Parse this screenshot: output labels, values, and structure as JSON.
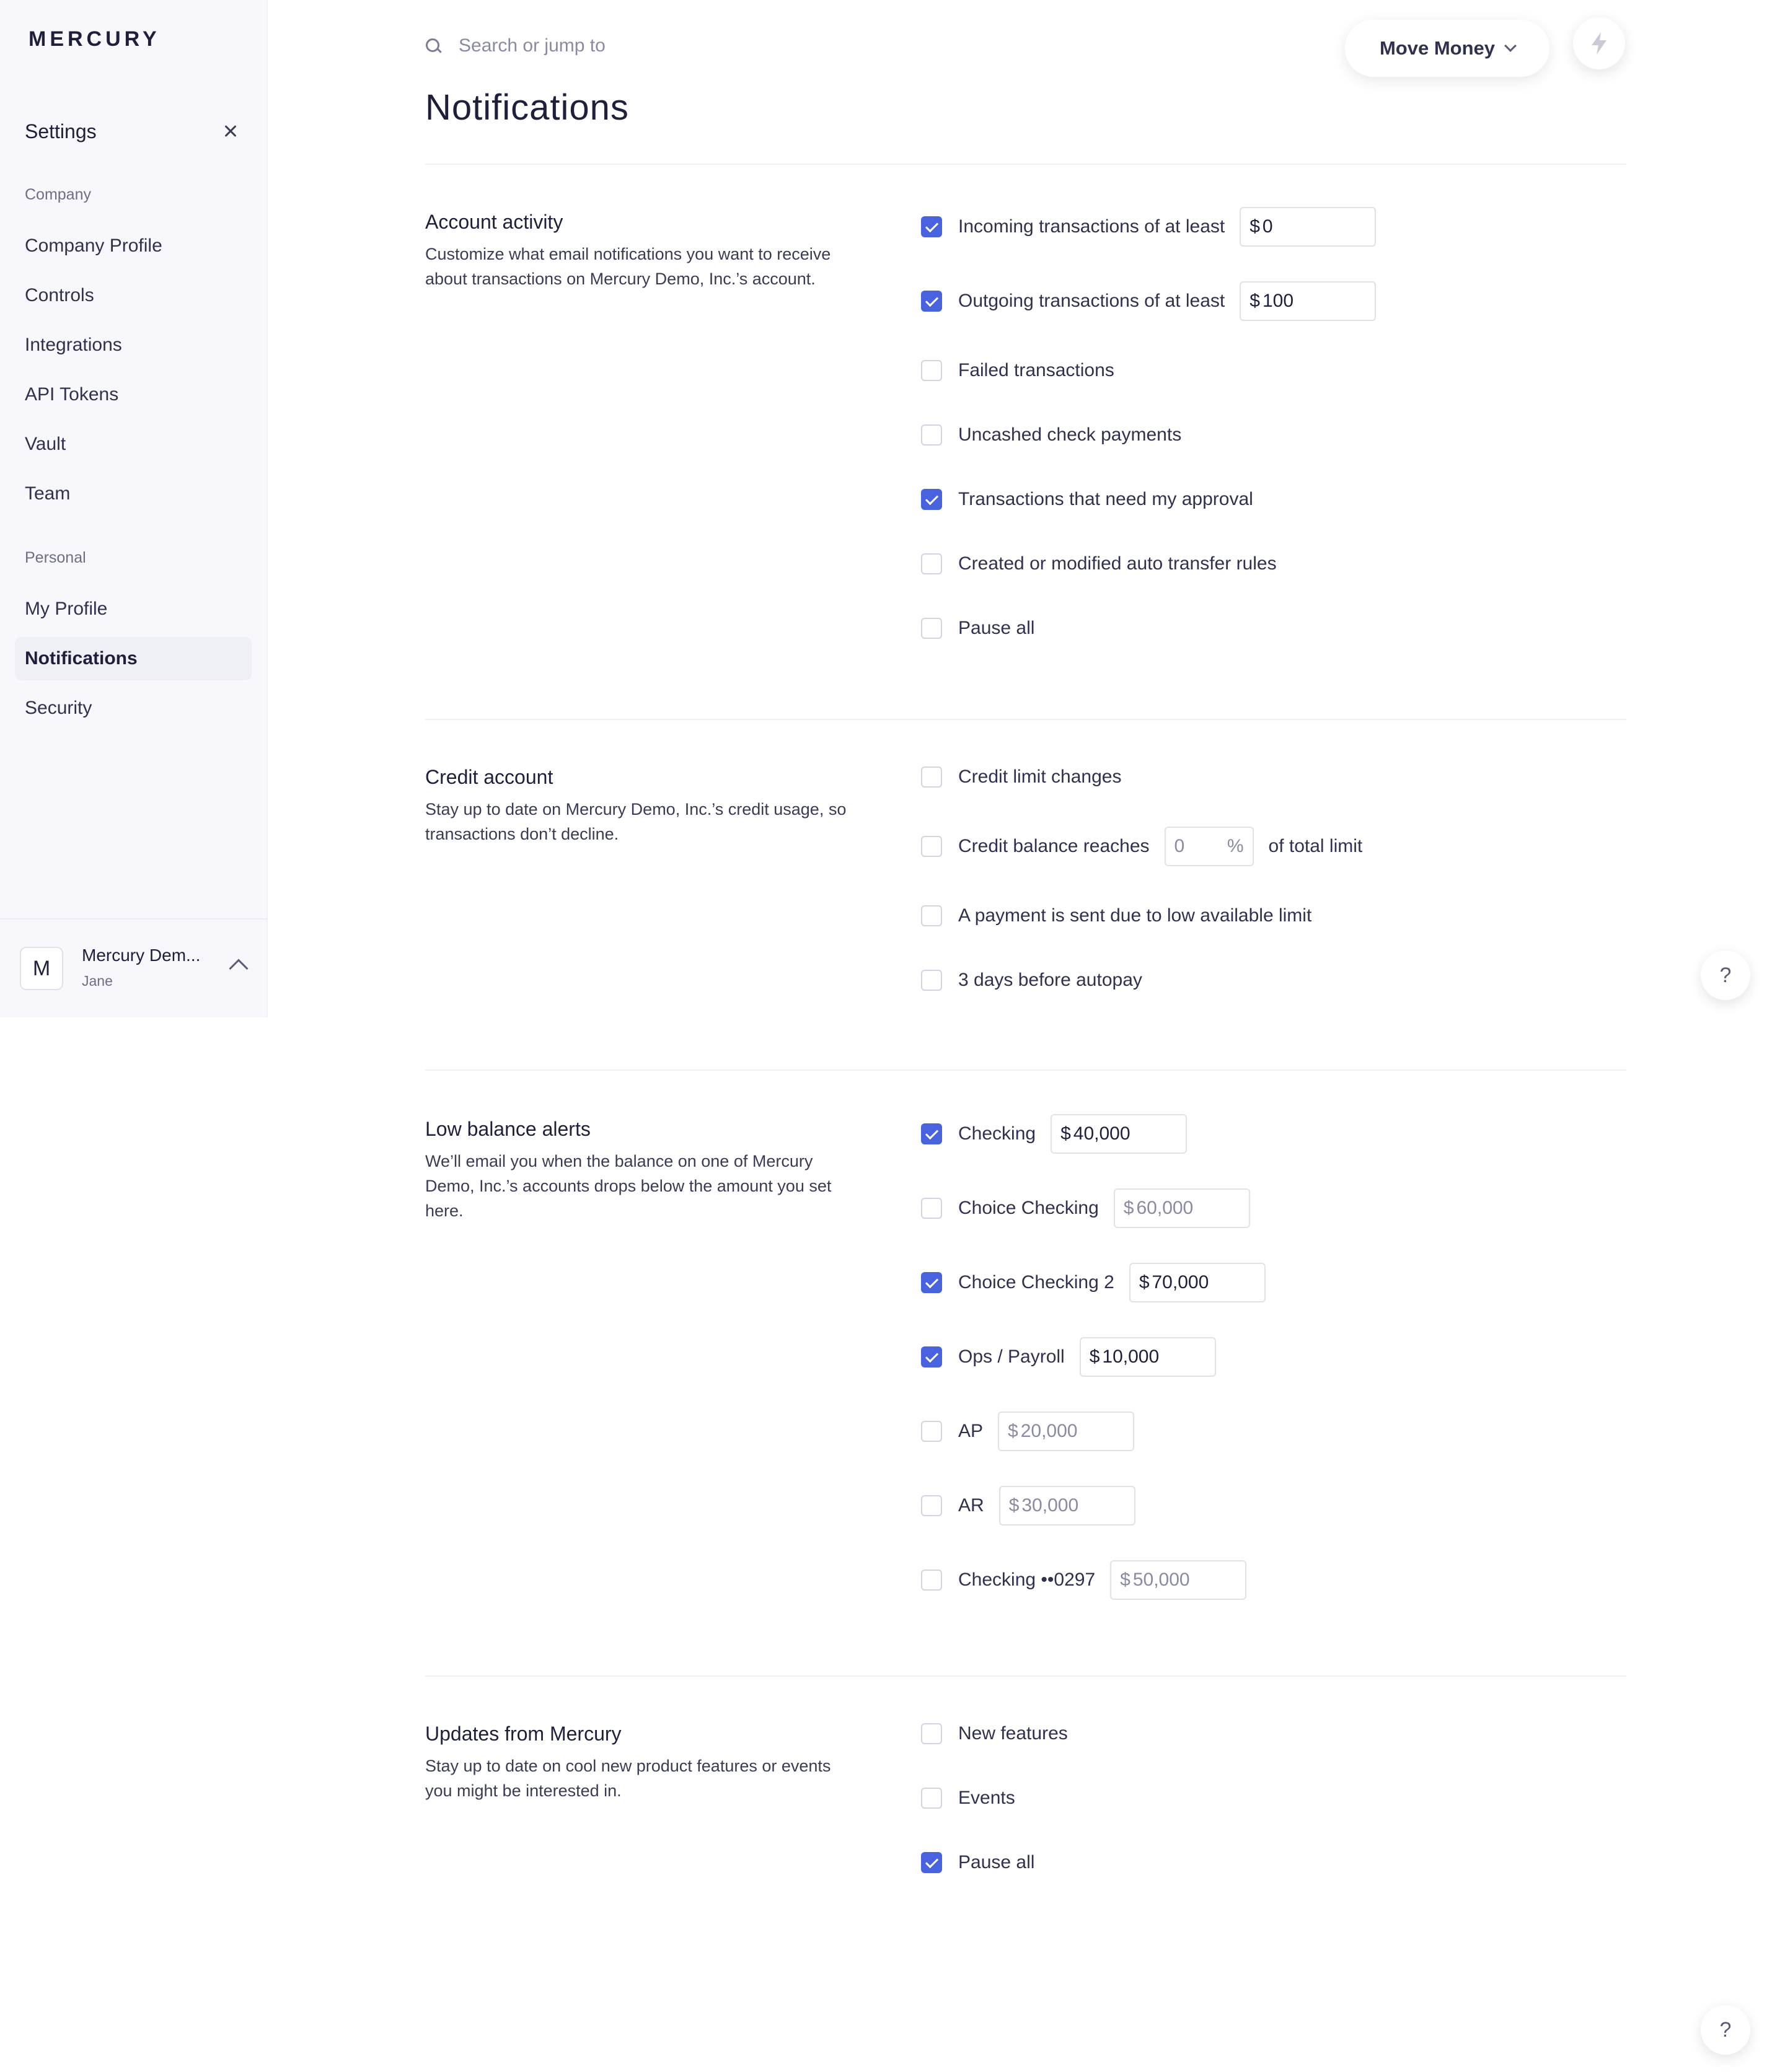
{
  "sidebar": {
    "logo": "MERCURY",
    "settings_title": "Settings",
    "company_label": "Company",
    "company_items": [
      "Company Profile",
      "Controls",
      "Integrations",
      "API Tokens",
      "Vault",
      "Team"
    ],
    "personal_label": "Personal",
    "personal_items": [
      "My Profile",
      "Notifications",
      "Security"
    ],
    "active_item": "Notifications",
    "account": {
      "avatar_letter": "M",
      "name": "Mercury Dem...",
      "user": "Jane"
    }
  },
  "topbar": {
    "search_placeholder": "Search or jump to",
    "move_money_label": "Move Money",
    "help_label": "?"
  },
  "page_title": "Notifications",
  "sections": {
    "account_activity": {
      "title": "Account activity",
      "description": "Customize what email notifications you want to receive about transactions on Mercury Demo, Inc.’s account.",
      "options": [
        {
          "label": "Incoming transactions of at least",
          "checked": true,
          "amount": "0"
        },
        {
          "label": "Outgoing transactions of at least",
          "checked": true,
          "amount": "100"
        },
        {
          "label": "Failed transactions",
          "checked": false
        },
        {
          "label": "Uncashed check payments",
          "checked": false
        },
        {
          "label": "Transactions that need my approval",
          "checked": true
        },
        {
          "label": "Created or modified auto transfer rules",
          "checked": false
        },
        {
          "label": "Pause all",
          "checked": false
        }
      ]
    },
    "credit_account": {
      "title": "Credit account",
      "description": "Stay up to date on Mercury Demo, Inc.’s credit usage, so transactions don’t decline.",
      "options": [
        {
          "label": "Credit limit changes",
          "checked": false
        },
        {
          "label": "Credit balance reaches",
          "checked": false,
          "percent": "0",
          "percent_sign": "%",
          "suffix": "of total limit"
        },
        {
          "label": "A payment is sent due to low available limit",
          "checked": false
        },
        {
          "label": "3 days before autopay",
          "checked": false
        }
      ]
    },
    "low_balance": {
      "title": "Low balance alerts",
      "description": "We’ll email you when the balance on one of Mercury Demo, Inc.’s accounts drops below the amount you set here.",
      "options": [
        {
          "label": "Checking",
          "checked": true,
          "amount": "40,000"
        },
        {
          "label": "Choice Checking",
          "checked": false,
          "amount": "60,000"
        },
        {
          "label": "Choice Checking 2",
          "checked": true,
          "amount": "70,000"
        },
        {
          "label": "Ops / Payroll",
          "checked": true,
          "amount": "10,000"
        },
        {
          "label": "AP",
          "checked": false,
          "amount": "20,000"
        },
        {
          "label": "AR",
          "checked": false,
          "amount": "30,000"
        },
        {
          "label": "Checking ••0297",
          "checked": false,
          "amount": "50,000"
        }
      ]
    },
    "updates": {
      "title": "Updates from Mercury",
      "description": "Stay up to date on cool new product features or events you might be interested in.",
      "options": [
        {
          "label": "New features",
          "checked": false
        },
        {
          "label": "Events",
          "checked": false
        },
        {
          "label": "Pause all",
          "checked": true
        }
      ]
    }
  },
  "currency_symbol": "$",
  "colors": {
    "accent": "#4963e0",
    "text": "#1e1f3b",
    "sidebar_bg": "#f8f8fc"
  }
}
